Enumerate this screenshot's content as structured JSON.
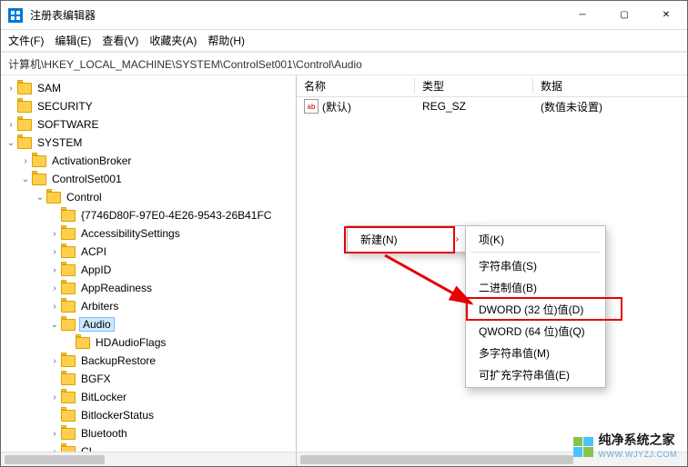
{
  "title": "注册表编辑器",
  "menu": {
    "file": "文件(F)",
    "edit": "编辑(E)",
    "view": "查看(V)",
    "favorites": "收藏夹(A)",
    "help": "帮助(H)"
  },
  "address": "计算机\\HKEY_LOCAL_MACHINE\\SYSTEM\\ControlSet001\\Control\\Audio",
  "columns": {
    "name": "名称",
    "type": "类型",
    "data": "数据"
  },
  "defaultValue": {
    "name": "(默认)",
    "type": "REG_SZ",
    "data": "(数值未设置)"
  },
  "tree": {
    "sam": "SAM",
    "security": "SECURITY",
    "software": "SOFTWARE",
    "system": "SYSTEM",
    "activationBroker": "ActivationBroker",
    "controlSet001": "ControlSet001",
    "control": "Control",
    "guidKey": "{7746D80F-97E0-4E26-9543-26B41FC",
    "accessibilitySettings": "AccessibilitySettings",
    "acpi": "ACPI",
    "appId": "AppID",
    "appReadiness": "AppReadiness",
    "arbiters": "Arbiters",
    "audio": "Audio",
    "hdAudioFlags": "HDAudioFlags",
    "backupRestore": "BackupRestore",
    "bgfx": "BGFX",
    "bitLocker": "BitLocker",
    "bitlockerStatus": "BitlockerStatus",
    "bluetooth": "Bluetooth",
    "ci": "CI"
  },
  "contextMenu": {
    "new": "新建(N)",
    "key": "项(K)",
    "string": "字符串值(S)",
    "binary": "二进制值(B)",
    "dword": "DWORD (32 位)值(D)",
    "qword": "QWORD (64 位)值(Q)",
    "multiString": "多字符串值(M)",
    "expandString": "可扩充字符串值(E)"
  },
  "watermark": {
    "title": "纯净系统之家",
    "sub": "WWW.WJYZJ.COM"
  }
}
